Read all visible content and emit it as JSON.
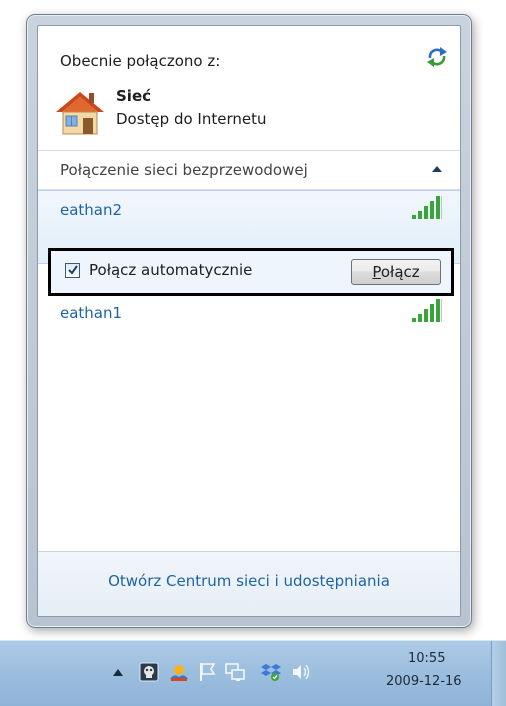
{
  "flyout": {
    "connected_to_label": "Obecnie połączono z:",
    "current_network": {
      "name": "Sieć",
      "access": "Dostęp do Internetu"
    },
    "wireless_section_label": "Połączenie sieci bezprzewodowej",
    "networks": [
      {
        "ssid": "eathan2",
        "signal_bars": 5,
        "selected": true
      },
      {
        "ssid": "eathan1",
        "signal_bars": 5,
        "selected": false
      }
    ],
    "auto_connect_label": "Połącz automatycznie",
    "auto_connect_checked": true,
    "connect_button": {
      "mnemonic": "P",
      "rest": "ołącz"
    },
    "footer_link": "Otwórz Centrum sieci i udostępniania"
  },
  "taskbar": {
    "clock_time": "10:55",
    "clock_date": "2009-12-16",
    "tray_icons": [
      "show-hidden-icons-chevron",
      "app-icon",
      "weather-icon",
      "action-center-flag-icon",
      "network-icon",
      "dropbox-icon",
      "volume-icon"
    ]
  },
  "colors": {
    "link_blue": "#1e64a5",
    "signal_green": "#3aa53a",
    "taskbar": "#9dbfdf"
  }
}
